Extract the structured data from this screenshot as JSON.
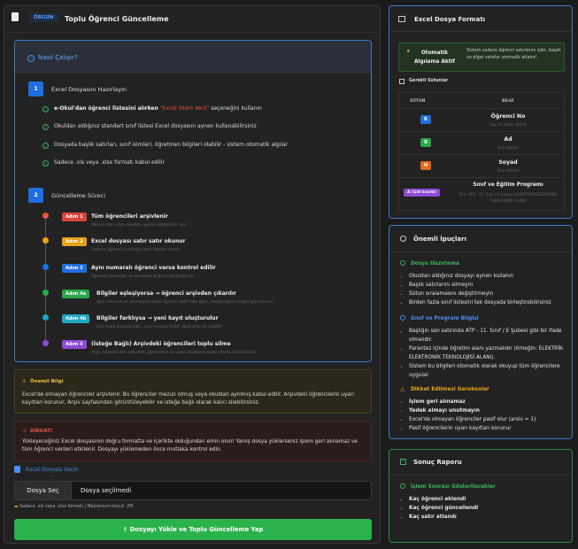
{
  "header": {
    "badge": "ÖRGÜN",
    "title": "Toplu Öğrenci Güncelleme"
  },
  "how": {
    "title": "Nasıl Çalışır?",
    "step1": {
      "num": "1",
      "title": "Excel Dosyasını Hazırlayın",
      "items": [
        {
          "pre": "e-Okul'dan öğrenci listesini alırken ",
          "red": "\"Excel (Ham Veri)\"",
          "post": " seçeneğini kullanın"
        },
        {
          "pre": "Okuldan aldığınız standart sınıf listesi Excel dosyasını aynen kullanabilirsiniz"
        },
        {
          "pre": "Dosyada başlık satırları, sınıf isimleri, öğretmen bilgileri olabilir - sistem otomatik algılar"
        },
        {
          "pre": "Sadece .xls veya .xlsx formatı kabul edilir"
        }
      ]
    },
    "step2": {
      "num": "2",
      "title": "Güncelleme Süreci",
      "steps": [
        {
          "pill": "Adım 1",
          "title": "Tüm öğrencileri arşivlenir",
          "sub": "Mezun olan veya okuldan ayrılan öğrenciler için"
        },
        {
          "pill": "Adım 2",
          "title": "Excel dosyası satır satır okunur",
          "sub": "Sadece öğrenci numarası olan satırlar işlenir"
        },
        {
          "pill": "Adım 3",
          "title": "Aynı numaralı öğrenci varsa kontrol edilir",
          "sub": "Öğrenci numarası ve ad-soyad bilgileri karşılaştırılır"
        },
        {
          "pill": "Adım 4a",
          "title": "Bilgiler eşleşiyorsa → öğrenci arşivden çıkarılır",
          "sub": "Aynı numara ve ad-soyada sahip öğrenci aktif hale gelir, sınıf/program bilgisi güncellenir"
        },
        {
          "pill": "Adım 4b",
          "title": "Bilgiler farklıysa → yeni kayıt oluşturulur",
          "sub": "Eski kayıt arşivde kalır, aynı numara farklı öğrenciye ait olabilir"
        },
        {
          "pill": "Adım 5",
          "title": "(İsteğe Bağlı) Arşivdeki öğrencileri toplu silme",
          "sub": "Arşiv sayfasından arşivdeki öğrencileri ve uyarı kayıtlarını kalıcı olarak silebilirsiniz"
        }
      ]
    }
  },
  "info_note": {
    "title": "Önemli Bilgi",
    "body": "Excel'de olmayan öğrenciler arşivlenir. Bu öğrenciler mezun olmuş veya okuldan ayrılmış kabul edilir. Arşivdeki öğrencilerin uyarı kayıtları korunur, Arşiv sayfasından görüntüleyebilir ve isteğe bağlı olarak kalıcı silebilirsiniz."
  },
  "warn_note": {
    "title": "DİKKAT!",
    "body": "Yükleyeceğiniz Excel dosyasının doğru formatta ve içerikte olduğundan emin olun! Yanlış dosya yüklerseniz işlem geri alınamaz ve tüm öğrenci verileri etkilenir. Dosyayı yüklemeden önce mutlaka kontrol edin."
  },
  "file": {
    "label": "Excel Dosyası Seçin",
    "button": "Dosya Seç",
    "none": "Dosya seçilmedi",
    "hint": "Sadece .xls veya .xlsx formatı | Maksimum boyut: 2M"
  },
  "upload_button": "Dosyayı Yükle ve Toplu Güncelleme Yap",
  "format": {
    "title": "Excel Dosya Formatı",
    "auto_label": "Otomatik Algılama Aktif",
    "auto_desc": "Sistem sadece öğrenci satırlarını işler, başlık ve diğer satırlar otomatik atlanır!",
    "required": "Gerekli Sütunlar",
    "col_header": "SÜTUN",
    "info_header": "BİLGİ",
    "rows": [
      {
        "col": "B",
        "name": "Öğrenci No",
        "desc": "Sayısal değer olmalı",
        "color": "#1f6fe0"
      },
      {
        "col": "D",
        "name": "Ad",
        "desc": "Boş olamaz",
        "color": "#2aa84a"
      },
      {
        "col": "H",
        "name": "Soyad",
        "desc": "Boş olamaz",
        "color": "#e06a1f"
      },
      {
        "col": "A (üst kısım)",
        "name": "Sınıf ve Eğitim Programı",
        "desc": "Örn: ATP - 11. Sınıf / E Şubesi (ELEKTRİK-ELEKTRONİK TEKNOLOJİSİ ALANI)",
        "color": "#8f4ad6"
      }
    ]
  },
  "tips": {
    "title": "Önemli İpuçları",
    "sec1": "Dosya Hazırlama",
    "sec1_items": [
      "Okuldan aldığınız dosyayı aynen kullanın",
      "Başlık satırlarını silmeyin",
      "Sütun sıralamasını değiştirmeyin",
      "Birden fazla sınıf listesini tek dosyada birleştirebilirsiniz"
    ],
    "sec2": "Sınıf ve Program Bilgisi",
    "sec2_items": [
      "Başlığın son satırında ATP - 11. Sınıf / E Şubesi gibi bir ifade olmalıdır.",
      "Parantez içinde öğretim alanı yazmalıdır (örneğin: ELEKTRİK-ELEKTRONİK TEKNOLOJİSİ ALANI).",
      "Sistem bu bilgileri otomatik olarak okuyup tüm öğrencilere uygular."
    ],
    "sec3": "Dikkat Edilmesi Gerekenler",
    "sec3_items": [
      "İşlem geri alınamaz",
      "Yedek almayı unutmayın",
      "Excel'de olmayan öğrenciler pasif olur (arsiv = 1)",
      "Pasif öğrencilerin uyarı kayıtları korunur"
    ]
  },
  "report": {
    "title": "Sonuç Raporu",
    "section": "İşlem Sonrası Gösterilecekler",
    "items": [
      "Kaç öğrenci eklendi",
      "Kaç öğrenci güncellendi",
      "Kaç satır atlandı"
    ]
  },
  "colors": {
    "accent_blue": "#3b7bd0",
    "green": "#2ab24b",
    "step_colors": [
      "#e6534b",
      "#e6a019",
      "#1f6fe0",
      "#2aa84a",
      "#1fa8c0",
      "#8f4ad6"
    ]
  }
}
